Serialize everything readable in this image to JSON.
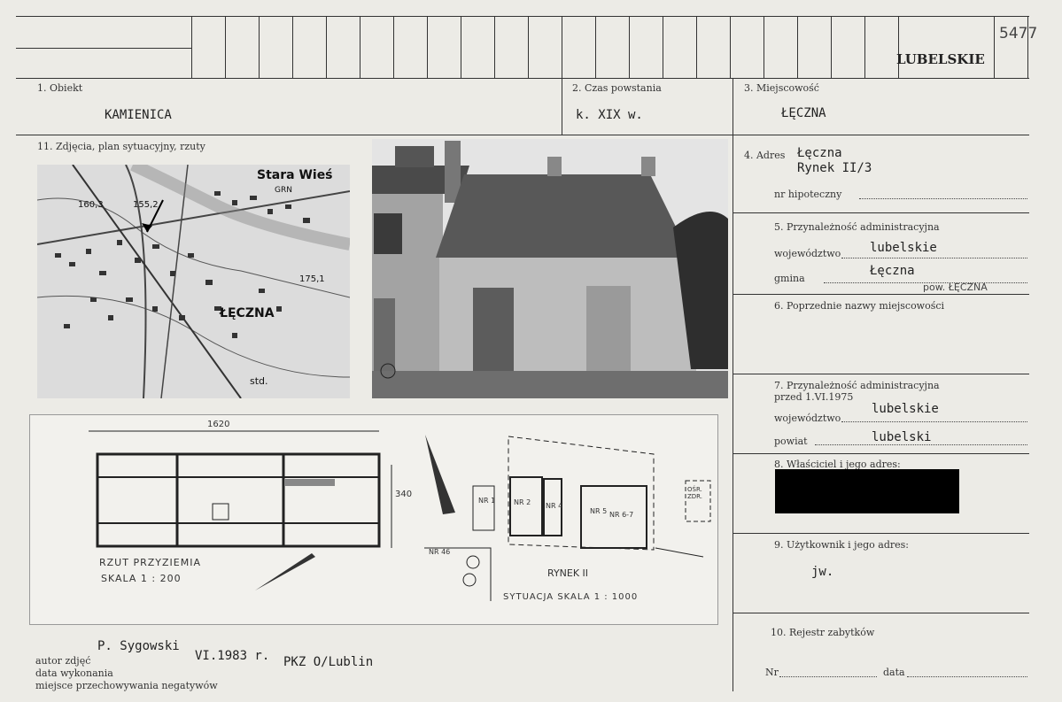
{
  "header": {
    "region": "LUBELSKIE",
    "catalog_number": "5477"
  },
  "fields": {
    "obiekt_label": "1. Obiekt",
    "obiekt_value": "KAMIENICA",
    "czas_label": "2. Czas powstania",
    "czas_value": "k. XIX w.",
    "miejscowosc_label": "3. Miejscowość",
    "miejscowosc_value": "ŁĘCZNA",
    "zdjecia_label": "11. Zdjęcia, plan sytuacyjny, rzuty",
    "adres_label": "4. Adres",
    "adres_line1": "Łęczna",
    "adres_line2": "Rynek II/3",
    "hipoteczny_label": "nr  hipoteczny",
    "przynaleznosc_label": "5. Przynależność administracyjna",
    "wojewodztwo_label": "województwo",
    "wojewodztwo_value": "lubelskie",
    "gmina_label": "gmina",
    "gmina_value": "Łęczna",
    "gmina_note": "pow. ŁĘCZNA",
    "poprzednie_label": "6. Poprzednie nazwy miejscowości",
    "przynaleznosc75_label": "7. Przynależność administracyjna",
    "przynaleznosc75_sub": "przed  1.VI.1975",
    "wojewodztwo75_label": "województwo",
    "wojewodztwo75_value": "lubelskie",
    "powiat_label": "powiat",
    "powiat_value": "lubelski",
    "wlasciciel_label": "8. Właściciel i jego adres:",
    "uzytkownik_label": "9. Użytkownik i jego adres:",
    "uzytkownik_value": "jw.",
    "rejestr_label": "10. Rejestr zabytków",
    "nr_label": "Nr",
    "data_label": "data"
  },
  "footer": {
    "autor_label": "autor zdjęć",
    "data_label": "data wykonania",
    "miejsce_label": "miejsce przechowywania negatywów",
    "autor_value": "P. Sygowski",
    "data_value": "VI.1983 r.",
    "miejsce_value": "PKZ O/Lublin"
  },
  "map": {
    "place_label": "ŁĘCZNA",
    "village_label": "Stara Wieś",
    "grn_label": "GRN",
    "elev1": "160,3",
    "elev2": "155,2",
    "elev3": "175,1",
    "std_label": "std."
  },
  "plan": {
    "dimension_width": "1620",
    "dimension_depth": "340",
    "floor_title": "RZUT PRZYZIEMIA",
    "floor_scale": "SKALA   1 : 200",
    "square_label": "RYNEK II",
    "situation_title": "SYTUACJA    SKALA  1 : 1000",
    "lot1": "NR 1",
    "lot2": "NR 2",
    "lot4": "NR 4",
    "lot5": "NR 5",
    "lot67": "NR 6-7",
    "lot46": "NR 46",
    "osr": "OŚR. ZDR."
  }
}
